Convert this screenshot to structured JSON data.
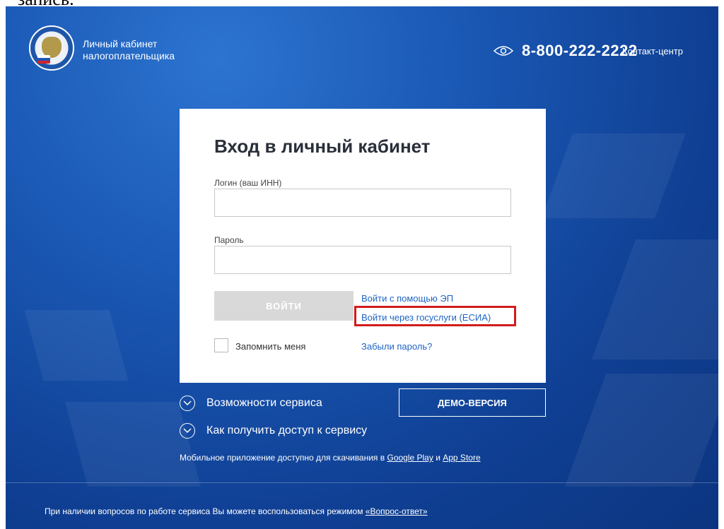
{
  "stray_text": "записв.",
  "header": {
    "title_line1": "Личный кабинет",
    "title_line2": "налогоплательщика",
    "phone": "8-800-222-2222",
    "contact_link": "Контакт-центр"
  },
  "login": {
    "title": "Вход в личный кабинет",
    "login_label": "Логин (ваш ИНН)",
    "login_value": "",
    "password_label": "Пароль",
    "password_value": "",
    "submit_label": "ВОЙТИ",
    "link_ep": "Войти с помощью ЭП",
    "link_esia": "Войти через госуслуги (ЕСИА)",
    "remember_label": "Запомнить меня",
    "forgot_link": "Забыли пароль?"
  },
  "below": {
    "features": "Возможности сервиса",
    "access": "Как получить доступ к сервису",
    "demo_button": "ДЕМО-ВЕРСИЯ",
    "mobile_prefix": "Мобильное приложение доступно для скачивания в",
    "google_play": "Google Play",
    "and": "и",
    "app_store": "App Store"
  },
  "footer": {
    "text": "При наличии вопросов по работе сервиса Вы можете воспользоваться режимом",
    "faq_link": "«Вопрос-ответ»"
  },
  "colors": {
    "background": "#1a58b4",
    "link": "#1e64c3",
    "highlight": "#d11c1c",
    "disabled_button": "#d9d9d9"
  }
}
